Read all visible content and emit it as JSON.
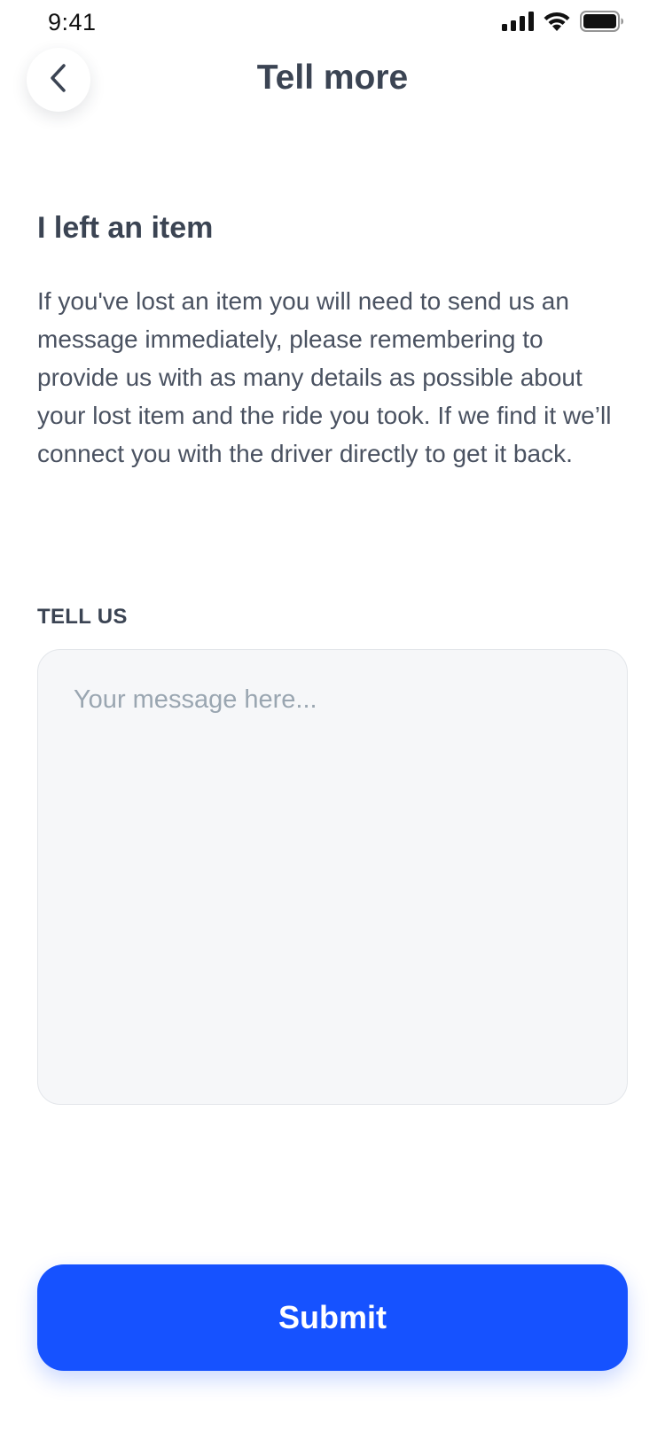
{
  "status_bar": {
    "time": "9:41",
    "icons": [
      "signal-icon",
      "wifi-icon",
      "battery-icon"
    ]
  },
  "header": {
    "title": "Tell more",
    "back_icon": "chevron-left-icon"
  },
  "content": {
    "heading": "I left an item",
    "description": "If you've lost an item you will need to send us an message immediately, please remembering to provide us with as many details as possible about your lost item and the ride you took. If we find it we’ll connect you with the driver directly to get it back."
  },
  "form": {
    "label": "TELL US",
    "placeholder": "Your message here...",
    "value": ""
  },
  "actions": {
    "submit_label": "Submit"
  },
  "colors": {
    "primary": "#1652ff",
    "text": "#3b4453",
    "input_bg": "#f6f7f9",
    "placeholder": "#9aa6b1"
  }
}
